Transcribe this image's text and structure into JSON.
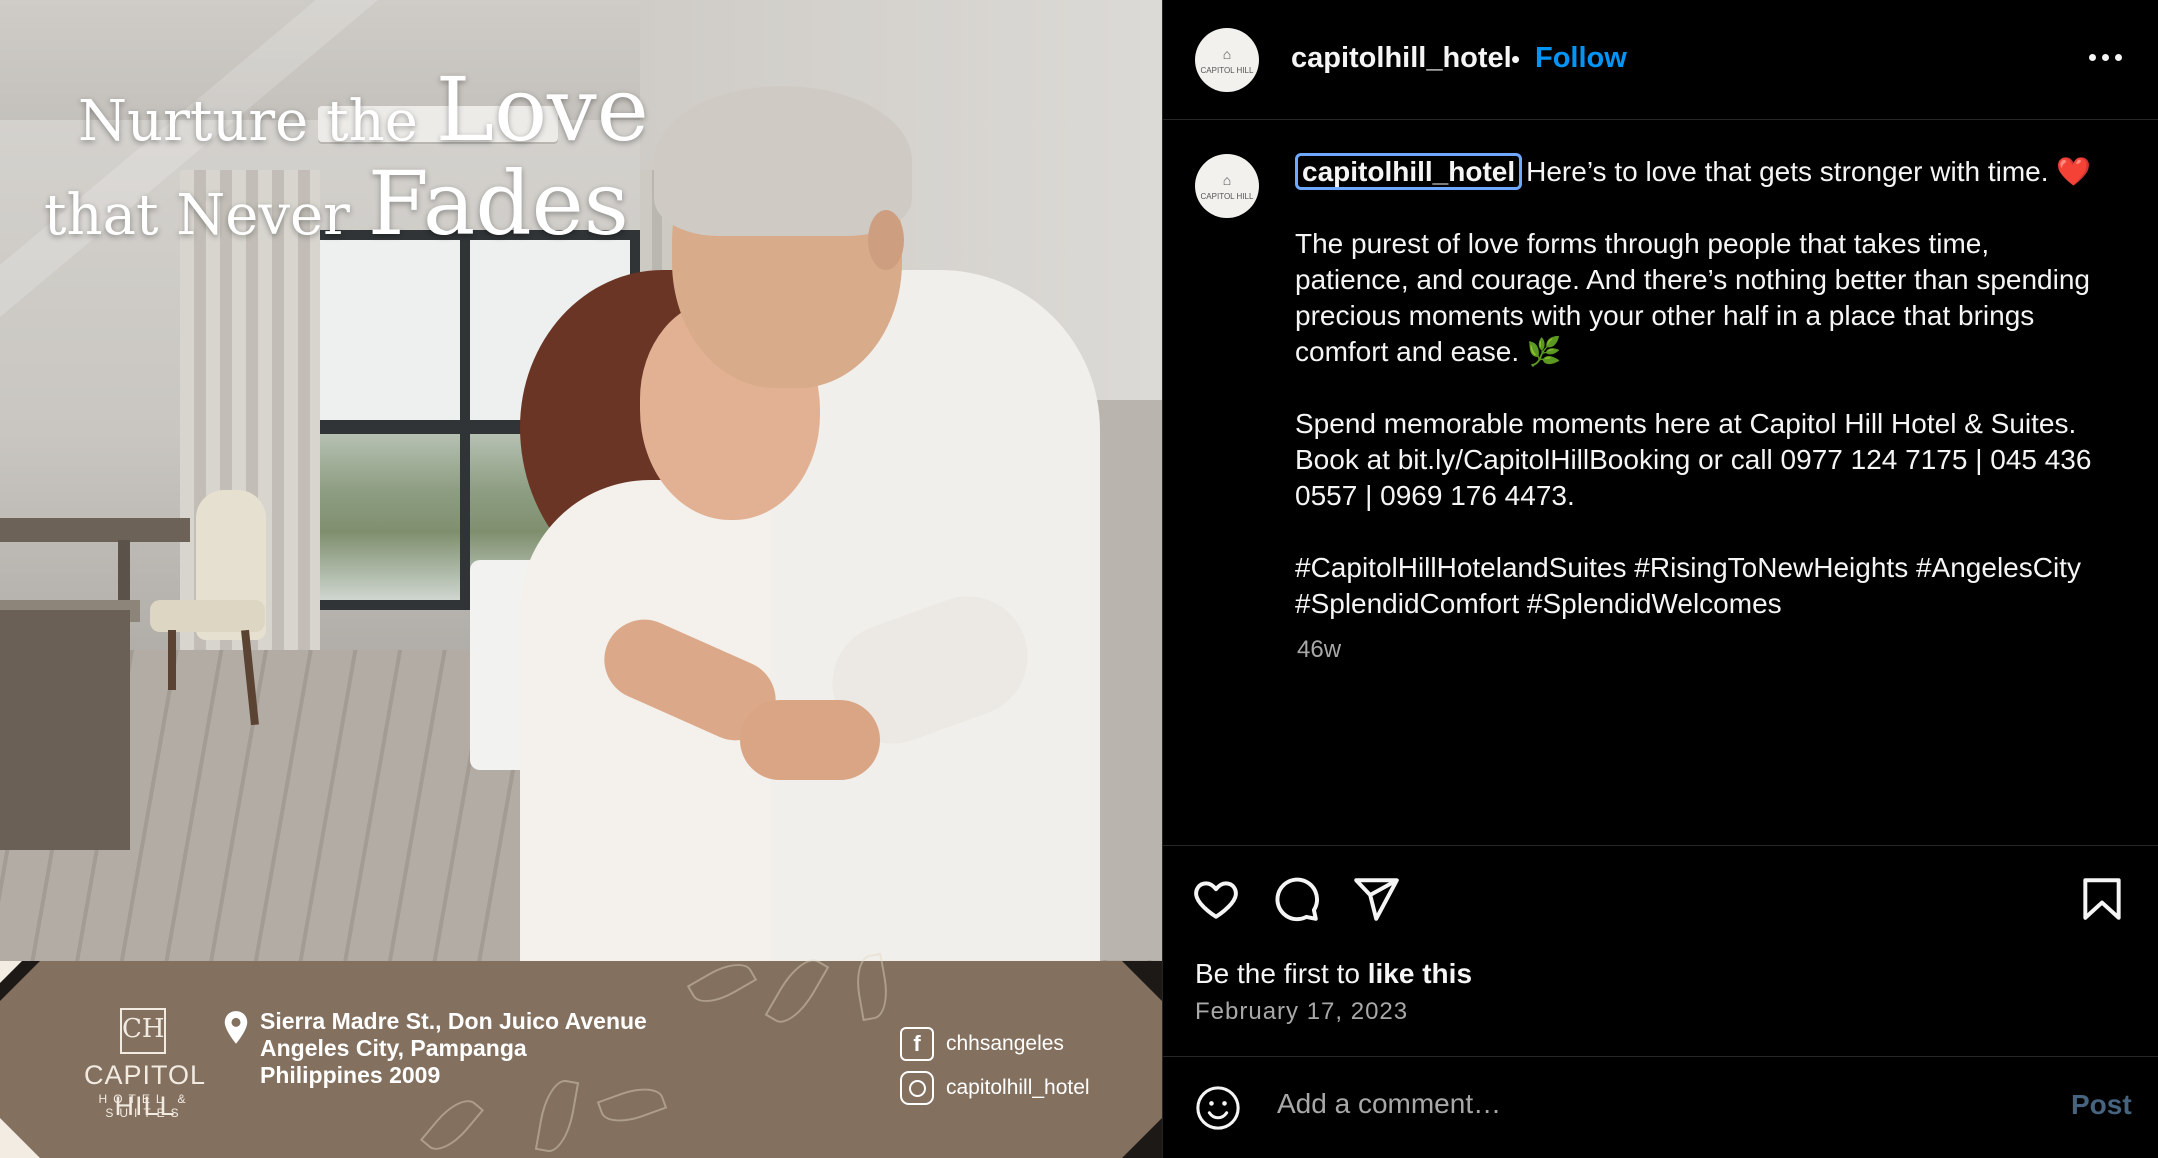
{
  "post_image": {
    "headline_line1_small": "Nurture the",
    "headline_line1_big": "Love",
    "headline_line2_small": "that Never",
    "headline_line2_big": "Fades",
    "brand_name": "CAPITOL HILL",
    "brand_sub": "HOTEL & SUITES",
    "brand_mark": "CH",
    "address_lines": [
      "Sierra Madre St., Don Juico Avenue",
      "Angeles City, Pampanga",
      "Philippines 2009"
    ],
    "facebook_handle": "chhsangeles",
    "instagram_handle": "capitolhill_hotel"
  },
  "header": {
    "username": "capitolhill_hotel",
    "separator": "•",
    "follow_label": "Follow"
  },
  "caption": {
    "username": "capitolhill_hotel",
    "line1": "Here’s to love that gets stronger with time. ❤️",
    "para2": "The purest of love forms through people that takes time, patience, and courage. And there’s nothing better than spending precious moments with your other half in a place that brings comfort and ease. 🌿",
    "para3": "Spend memorable moments here at Capitol Hill Hotel & Suites. Book at bit.ly/CapitolHillBooking or call 0977 124 7175 | 045 436 0557 | 0969 176 4473.",
    "hashtags": "#CapitolHillHotelandSuites #RisingToNewHeights #AngelesCity #SplendidComfort #SplendidWelcomes",
    "time_ago": "46w"
  },
  "actions": {
    "icons": [
      "heart-icon",
      "comment-icon",
      "share-icon",
      "bookmark-icon"
    ],
    "likes_prefix": "Be the first to",
    "likes_action": "like this",
    "date": "February 17, 2023"
  },
  "comment": {
    "placeholder": "Add a comment…",
    "post_label": "Post"
  },
  "colors": {
    "background": "#000000",
    "follow_blue": "#0095f6",
    "post_disabled": "#46637f",
    "band_brown": "#83705f"
  }
}
